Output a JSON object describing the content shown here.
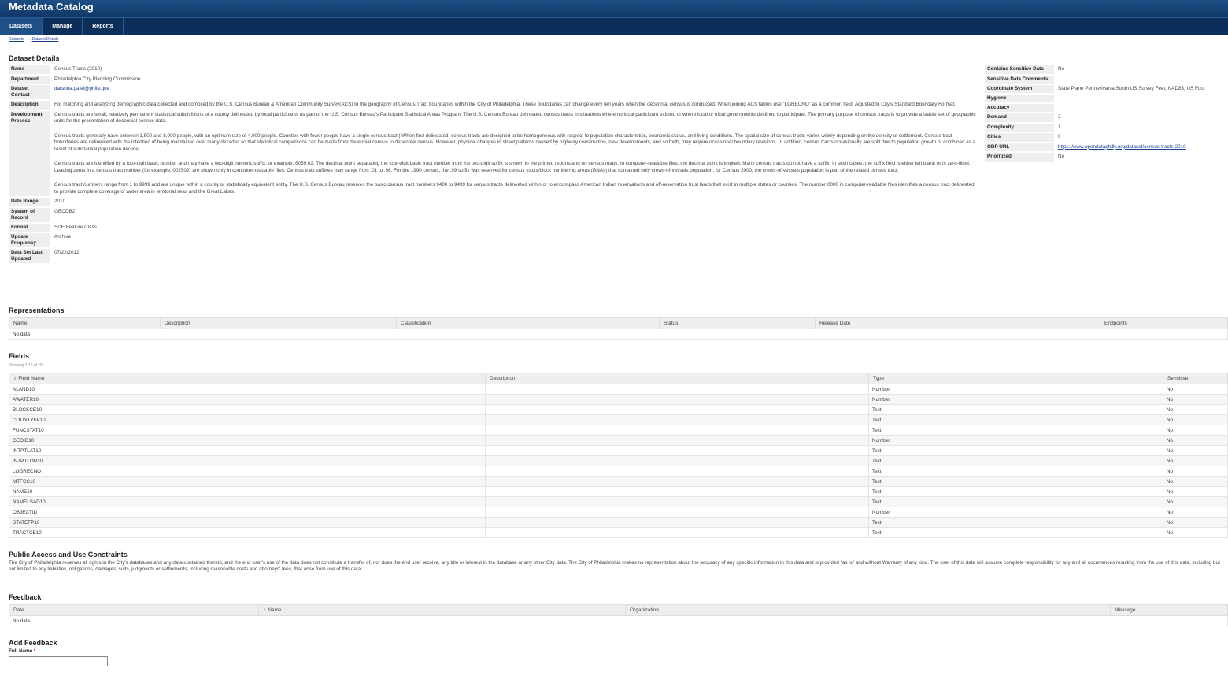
{
  "app": {
    "title": "Metadata Catalog"
  },
  "nav": {
    "items": [
      "Datasets",
      "Manage",
      "Reports"
    ]
  },
  "breadcrumb": {
    "items": [
      "Datasets",
      "Dataset Details"
    ],
    "separator": "→"
  },
  "details": {
    "heading": "Dataset Details",
    "left": [
      {
        "label": "Name",
        "value": "Census Tracts (2010)"
      },
      {
        "label": "Department",
        "value": "Philadelphia City Planning Commission"
      },
      {
        "label": "Dataset Contact",
        "value": "darshna.patel@phila.gov",
        "link": true
      },
      {
        "label": "Description",
        "value": "For matching and analyzing demographic data collected and compiled by the U.S. Census Bureau & American Community Survey(ACS) to the geography of Census Tract boundaries within the City of Philadelphia. These boundaries can change every ten years when the decennial census is conducted. When joining ACS tables use \"LGRECNO\" as a common field. Adjusted to City's Standard Boundary Format."
      },
      {
        "label": "Development Process",
        "paragraphs": [
          "Census tracts are small, relatively permanent statistical subdivisions of a county delineated by local participants as part of the U.S. Census Bureau's Participant Statistical Areas Program. The U.S. Census Bureau delineated census tracts in situations where no local participant existed or where local or tribal governments declined to participate. The primary purpose of census tracts is to provide a stable set of geographic units for the presentation of decennial census data.",
          "Census tracts generally have between 1,500 and 8,000 people, with an optimum size of 4,000 people. Counties with fewer people have a single census tract.) When first delineated, census tracts are designed to be homogeneous with respect to population characteristics, economic status, and living conditions. The spatial size of census tracts varies widely depending on the density of settlement. Census tract boundaries are delineated with the intention of being maintained over many decades so that statistical comparisons can be made from decennial census to decennial census. However, physical changes in street patterns caused by highway construction, new developments, and so forth, may require occasional boundary revisions. In addition, census tracts occasionally are split due to population growth or combined as a result of substantial population decline.",
          "Census tracts are identified by a four-digit basic number and may have a two-digit numeric suffix; or example, 6059.02. The decimal point separating the four-digit basic tract number from the two-digit suffix is shown in the printed reports and on census maps. In computer-readable files, the decimal point is implied. Many census tracts do not have a suffix; in such cases, the suffix field is either left blank or is zero-filled. Leading zeros in a census tract number (for example, 002502) are shown only in computer-readable files. Census tract suffixes may range from .01 to .98. For the 1990 census, the .99 suffix was reserved for census tracts/block numbering areas (BNAs) that contained only crews-of-vessels population; for Census 2000, the crews-of-vessels population is part of the related census tract.",
          "Census tract numbers range from 1 to 9999 and are unique within a county or statistically equivalent entity. The U.S. Census Bureau reserves the basic census tract numbers 9400 to 9499 for census tracts delineated within or to encompass American Indian reservations and off-reservation trust lands that exist in multiple states or counties. The number 0000 in computer-readable files identifies a census tract delineated to provide complete coverage of water area in territorial seas and the Great Lakes."
        ]
      },
      {
        "label": "Date Range",
        "value": "2010"
      },
      {
        "label": "System of Record",
        "value": "GEODB2"
      },
      {
        "label": "Format",
        "value": "SDE Feature Class"
      },
      {
        "label": "Update Frequency",
        "value": "Archive"
      },
      {
        "label": "Data Set Last Updated",
        "value": "07/22/2012"
      }
    ],
    "right": [
      {
        "label": "Contains Sensitive Data",
        "value": "No"
      },
      {
        "label": "Sensitive Data Comments",
        "value": ""
      },
      {
        "label": "Coordinate System",
        "value": "State Plane Pennsylvania South US Survey Feet, NAD83, US Foot"
      },
      {
        "label": "Hygiene",
        "value": ""
      },
      {
        "label": "Accuracy",
        "value": ""
      },
      {
        "label": "Demand",
        "value": "2"
      },
      {
        "label": "Complexity",
        "value": "1"
      },
      {
        "label": "Cities",
        "value": "0"
      },
      {
        "label": "ODP URL",
        "value": "https://www.opendataphilly.org/dataset/census-tracts-2010",
        "link": true
      },
      {
        "label": "Prioritized",
        "value": "No"
      }
    ]
  },
  "representations": {
    "heading": "Representations",
    "columns": [
      "Name",
      "Description",
      "Classification",
      "Status",
      "Release Date",
      "Endpoints"
    ],
    "empty": "No data"
  },
  "fields": {
    "heading": "Fields",
    "showing": "Showing 1-15 of 15",
    "columns": [
      "Field Name",
      "Description",
      "Type",
      "Sensitive"
    ],
    "rows": [
      [
        "ALAND10",
        "",
        "Number",
        "No"
      ],
      [
        "AWATER10",
        "",
        "Number",
        "No"
      ],
      [
        "BLOCKCE10",
        "",
        "Text",
        "No"
      ],
      [
        "COUNTYFP10",
        "",
        "Text",
        "No"
      ],
      [
        "FUNCSTAT10",
        "",
        "Text",
        "No"
      ],
      [
        "GEOID10",
        "",
        "Number",
        "No"
      ],
      [
        "INTPTLAT10",
        "",
        "Text",
        "No"
      ],
      [
        "INTPTLON10",
        "",
        "Text",
        "No"
      ],
      [
        "LOGRECNO",
        "",
        "Text",
        "No"
      ],
      [
        "MTFCC10",
        "",
        "Text",
        "No"
      ],
      [
        "NAME10",
        "",
        "Text",
        "No"
      ],
      [
        "NAMELSAD10",
        "",
        "Text",
        "No"
      ],
      [
        "OBJECTID",
        "",
        "Number",
        "No"
      ],
      [
        "STATEFP10",
        "",
        "Text",
        "No"
      ],
      [
        "TRACTCE10",
        "",
        "Text",
        "No"
      ]
    ]
  },
  "constraints": {
    "heading": "Public Access and Use Constraints",
    "text": "The City of Philadelphia reserves all rights in the City's databases and any data contained therein, and the end user's use of the data does not constitute a transfer of, nor does the end user receive, any title or interest in the database or any other City data. The City of Philadelphia makes no representation about the accuracy of any specific information in this data and is provided \"as is\" and without Warranty of any kind. The user of this data will assume complete responsibility for any and all occurrences resulting from the use of this data, including but not limited to any liabilities, obligations, damages, suits, judgments or settlements, including reasonable costs and attorneys' fees, that arise from use of this data."
  },
  "feedback": {
    "heading": "Feedback",
    "columns": [
      "Date",
      "Name",
      "Organization",
      "Message"
    ],
    "empty": "No data"
  },
  "add_feedback": {
    "heading": "Add Feedback",
    "full_name_label": "Full Name",
    "required_mark": "*"
  }
}
